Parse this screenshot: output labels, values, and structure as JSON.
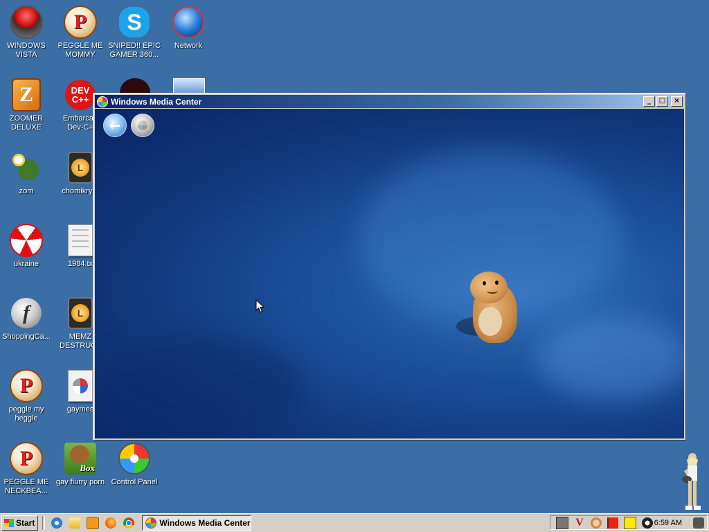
{
  "desktop": {
    "icons": [
      {
        "label": "WINDOWS\nVISTA"
      },
      {
        "label": "PEGGLE ME\nMOMMY"
      },
      {
        "label": "SNIPED!! EPIC\nGAMER 360..."
      },
      {
        "label": "Network"
      },
      {
        "label": "ZOOMER\nDELUXE"
      },
      {
        "label": "Embarcad\nDev-C+"
      },
      {
        "label": "zom"
      },
      {
        "label": "chomikrypt"
      },
      {
        "label": "ukraine"
      },
      {
        "label": "1984.tx"
      },
      {
        "label": "ShoppingCa..."
      },
      {
        "label": "MEMZ\nDESTRUCT"
      },
      {
        "label": "peggle my\nheggle"
      },
      {
        "label": "gaymes"
      },
      {
        "label": "PEGGLE ME\nNECKBEA..."
      },
      {
        "label": "gay flurry porn"
      },
      {
        "label": "Control Panel"
      }
    ],
    "icon_art_text": {
      "devcpp": "DEV\nC++",
      "box": "Box",
      "lock": "L",
      "peggle": "P",
      "flash": "f"
    }
  },
  "window": {
    "title": "Windows Media Center",
    "minimize": "_",
    "maximize": "□",
    "close": "×",
    "back_arrow": "←"
  },
  "taskbar": {
    "start_label": "Start",
    "task_button_label": "Windows Media Center",
    "clock": "6:59 AM",
    "quick_launch": [
      "internet-explorer-icon",
      "folder-icon",
      "media-player-icon",
      "firefox-icon",
      "chrome-icon"
    ],
    "tray_icons": [
      "network-icon",
      "antivirus-icon",
      "search-icon",
      "flag-icon",
      "display-icon",
      "speaker-icon"
    ]
  },
  "colors": {
    "desktop_bg": "#3a6ea5",
    "title_active": "#0a246a",
    "wmc_bg": "#0f3479"
  }
}
